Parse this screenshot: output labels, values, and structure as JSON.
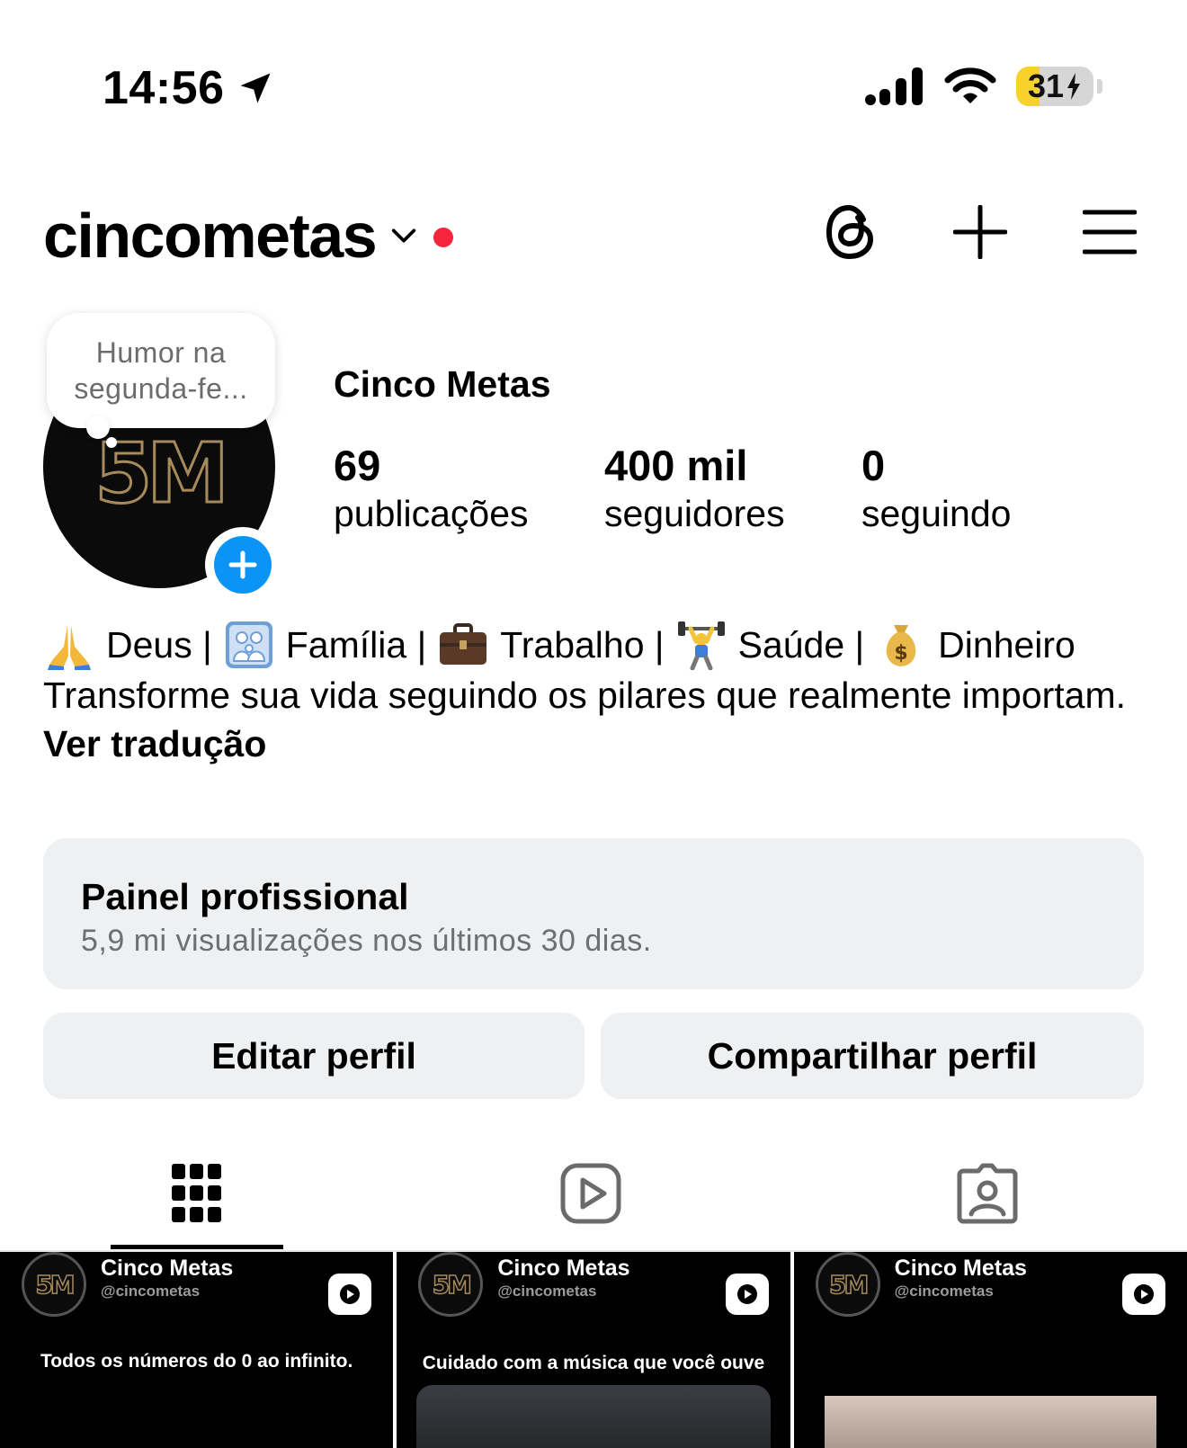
{
  "status_bar": {
    "time": "14:56",
    "battery": "31",
    "battery_color": "#f8d22a"
  },
  "header": {
    "username": "cincometas",
    "icons": [
      "threads-icon",
      "plus-icon",
      "menu-icon"
    ],
    "notification_dot_color": "#f6243c"
  },
  "profile": {
    "note": "Humor na segunda-fe...",
    "avatar_text": "5M",
    "display_name": "Cinco Metas",
    "stats": [
      {
        "value": "69",
        "label": "publicações"
      },
      {
        "value": "400 mil",
        "label": "seguidores"
      },
      {
        "value": "0",
        "label": "seguindo"
      }
    ]
  },
  "bio": {
    "pillars": [
      "Deus |",
      "Família |",
      "Trabalho |",
      "Saúde |",
      "Dinheiro"
    ],
    "pillar_icons": [
      "praying-hands-icon",
      "family-icon",
      "briefcase-icon",
      "weightlifter-icon",
      "money-bag-icon"
    ],
    "text": "Transforme sua vida seguindo os pilares que realmente importam.",
    "translate": "Ver tradução"
  },
  "dashboard": {
    "title": "Painel profissional",
    "subtitle": "5,9 mi visualizações nos últimos 30 dias."
  },
  "buttons": {
    "edit": "Editar perfil",
    "share": "Compartilhar perfil"
  },
  "tabs": [
    "grid-icon",
    "reels-icon",
    "tagged-icon"
  ],
  "posts": [
    {
      "name": "Cinco Metas",
      "handle": "@cincometas",
      "caption": "Todos os números do 0 ao infinito."
    },
    {
      "name": "Cinco Metas",
      "handle": "@cincometas",
      "caption": "Cuidado com a música que você ouve"
    },
    {
      "name": "Cinco Metas",
      "handle": "@cincometas",
      "caption": ""
    }
  ],
  "colors": {
    "accent_blue": "#0a95f6",
    "button_bg": "#eff0f2"
  }
}
